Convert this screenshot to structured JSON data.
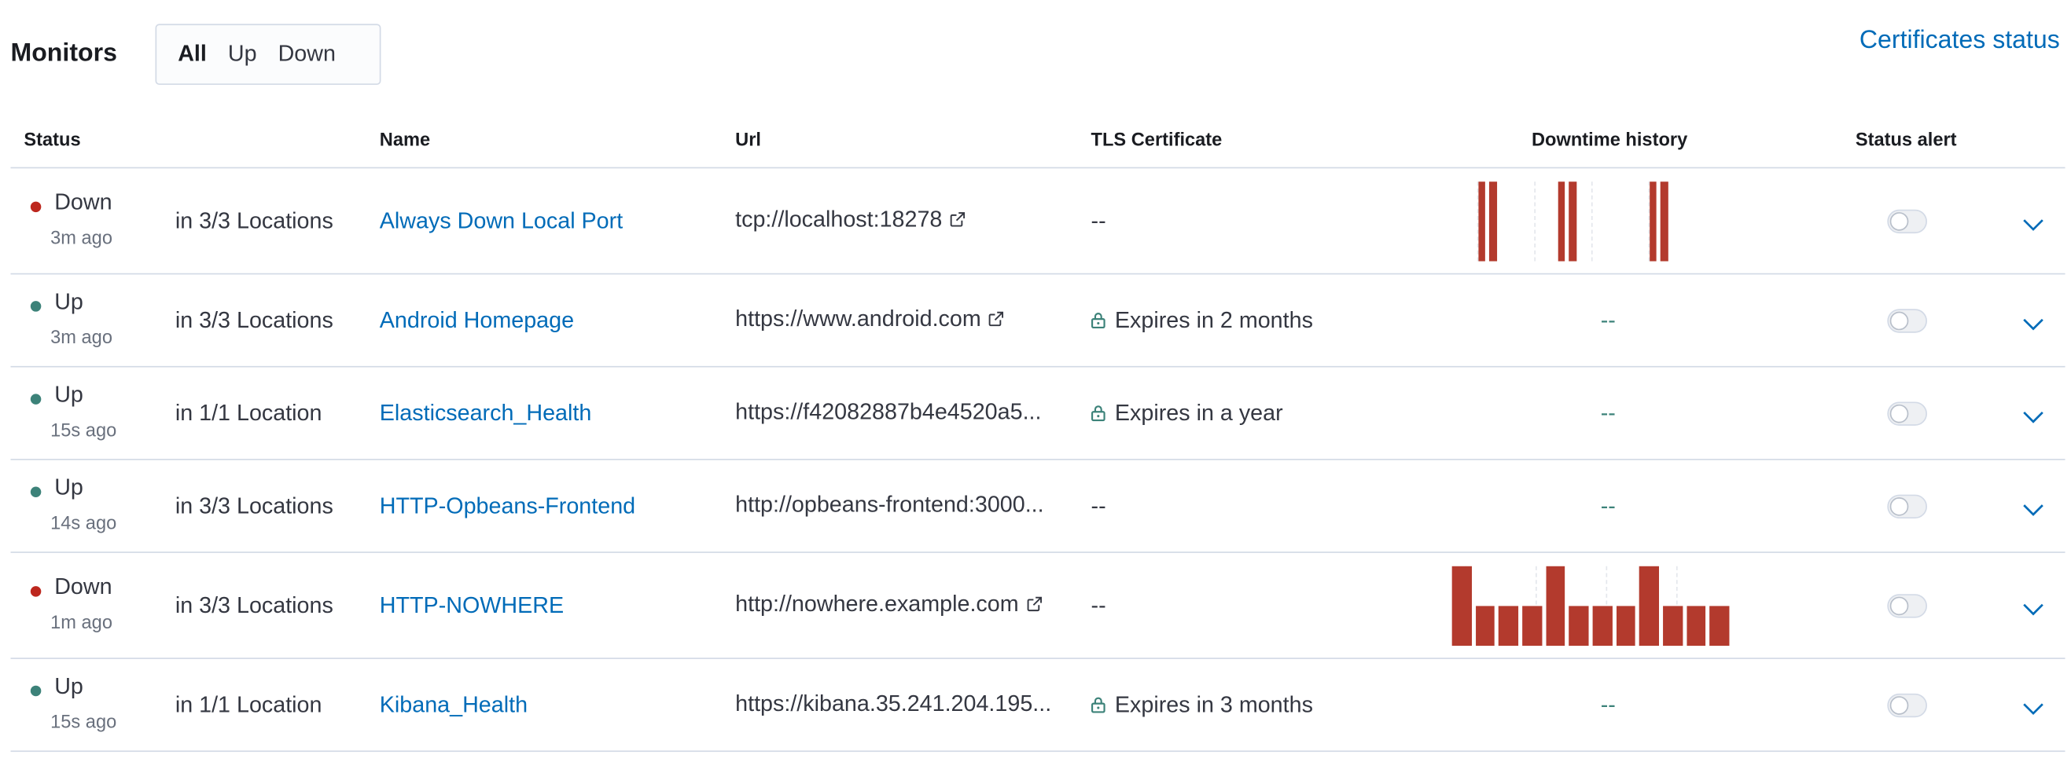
{
  "header": {
    "title": "Monitors",
    "filters": [
      "All",
      "Up",
      "Down"
    ],
    "active_filter": "All",
    "certificates_link": "Certificates status"
  },
  "columns": [
    "Status",
    "Name",
    "Url",
    "TLS Certificate",
    "Downtime history",
    "Status alert"
  ],
  "rows": [
    {
      "status": "Down",
      "ago": "3m ago",
      "locations": "in 3/3 Locations",
      "name": "Always Down Local Port",
      "url": "tcp://localhost:18278",
      "url_external": true,
      "tls": "--",
      "tls_lock": false,
      "history_text": "",
      "history": [
        0,
        1,
        1,
        0,
        0,
        0,
        0,
        0,
        1,
        1,
        0,
        0,
        0,
        0,
        0,
        0,
        1,
        1,
        0,
        0
      ],
      "alert_enabled": false
    },
    {
      "status": "Up",
      "ago": "3m ago",
      "locations": "in 3/3 Locations",
      "name": "Android Homepage",
      "url": "https://www.android.com",
      "url_external": true,
      "tls": "Expires in 2 months",
      "tls_lock": true,
      "history_text": "--",
      "history": [],
      "alert_enabled": false
    },
    {
      "status": "Up",
      "ago": "15s ago",
      "locations": "in 1/1 Location",
      "name": "Elasticsearch_Health",
      "url": "https://f42082887b4e4520a5...",
      "url_external": false,
      "tls": "Expires in a year",
      "tls_lock": true,
      "history_text": "--",
      "history": [],
      "alert_enabled": false
    },
    {
      "status": "Up",
      "ago": "14s ago",
      "locations": "in 3/3 Locations",
      "name": "HTTP-Opbeans-Frontend",
      "url": "http://opbeans-frontend:3000...",
      "url_external": false,
      "tls": "--",
      "tls_lock": false,
      "history_text": "--",
      "history": [],
      "alert_enabled": false
    },
    {
      "status": "Down",
      "ago": "1m ago",
      "locations": "in 3/3 Locations",
      "name": "HTTP-NOWHERE",
      "url": "http://nowhere.example.com",
      "url_external": true,
      "tls": "--",
      "tls_lock": false,
      "history_text": "",
      "history": [
        2,
        1,
        1,
        1,
        2,
        1,
        1,
        1,
        2,
        1,
        1,
        1
      ],
      "alert_enabled": false
    },
    {
      "status": "Up",
      "ago": "15s ago",
      "locations": "in 1/1 Location",
      "name": "Kibana_Health",
      "url": "https://kibana.35.241.204.195...",
      "url_external": false,
      "tls": "Expires in 3 months",
      "tls_lock": true,
      "history_text": "--",
      "history": [],
      "alert_enabled": false
    }
  ],
  "icons": {
    "external_link": "external-link-icon",
    "lock": "lock-icon",
    "expand": "chevron-down-icon"
  },
  "colors": {
    "link": "#006bb8",
    "down": "#bd271e",
    "up": "#3c8279",
    "downtime_bar": "#b33a2d",
    "border": "#d3dae6"
  }
}
